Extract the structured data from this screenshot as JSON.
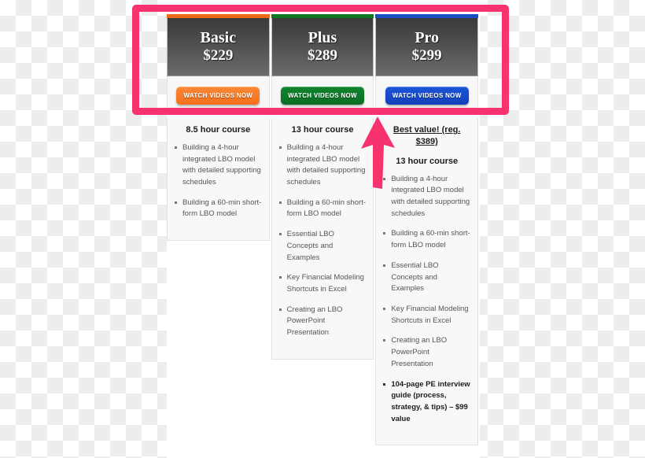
{
  "annotation": {
    "highlight_color": "#f7336f",
    "arrow_color": "#f7336f",
    "highlight_label": "pricing-plans-highlight",
    "arrow_label": "arrow-pointing-to-pro-plan"
  },
  "plans": [
    {
      "name": "Basic",
      "price": "$229",
      "accent_color": "#ee6b1a",
      "cta": "WATCH VIDEOS NOW",
      "cta_style": "cta-orange",
      "banner": null,
      "heading": "8.5 hour course",
      "features": [
        {
          "text": "Building a 4-hour integrated LBO model with detailed supporting schedules",
          "bold": false
        },
        {
          "text": "Building a 60-min short-form LBO model",
          "bold": false
        }
      ]
    },
    {
      "name": "Plus",
      "price": "$289",
      "accent_color": "#0c7a22",
      "cta": "WATCH VIDEOS NOW",
      "cta_style": "cta-green",
      "banner": null,
      "heading": "13 hour course",
      "features": [
        {
          "text": "Building a 4-hour integrated LBO model with detailed supporting schedules",
          "bold": false
        },
        {
          "text": "Building a 60-min short-form LBO model",
          "bold": false
        },
        {
          "text": "Essential LBO Concepts and Examples",
          "bold": false
        },
        {
          "text": "Key Financial Modeling Shortcuts in Excel",
          "bold": false
        },
        {
          "text": "Creating an LBO PowerPoint Presentation",
          "bold": false
        }
      ]
    },
    {
      "name": "Pro",
      "price": "$299",
      "accent_color": "#1a4fc4",
      "cta": "WATCH VIDEOS NOW",
      "cta_style": "cta-blue",
      "banner": "Best value! (reg. $389)",
      "heading": "13 hour course",
      "features": [
        {
          "text": "Building a 4-hour integrated LBO model with detailed supporting schedules",
          "bold": false
        },
        {
          "text": "Building a 60-min short-form LBO model",
          "bold": false
        },
        {
          "text": "Essential LBO Concepts and Examples",
          "bold": false
        },
        {
          "text": "Key Financial Modeling Shortcuts in Excel",
          "bold": false
        },
        {
          "text": "Creating an LBO PowerPoint Presentation",
          "bold": false
        },
        {
          "text": "104-page PE interview guide (process, strategy, & tips) – $99 value",
          "bold": true
        }
      ]
    }
  ]
}
